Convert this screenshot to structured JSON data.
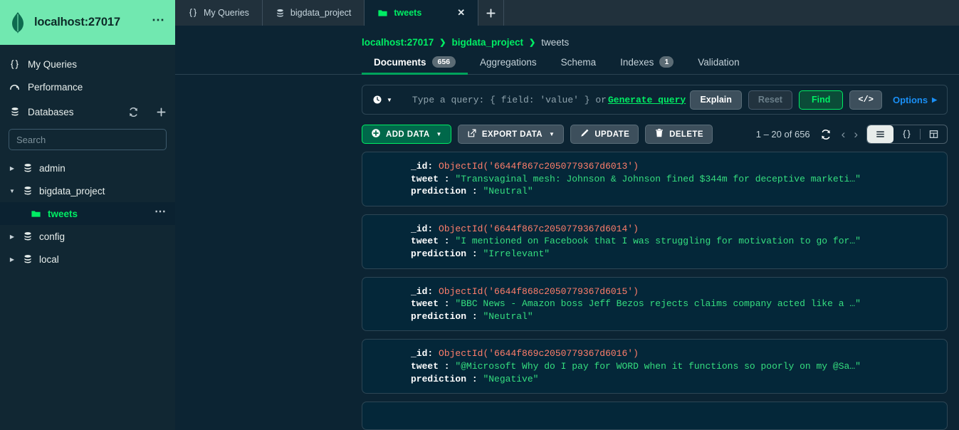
{
  "sidebar": {
    "host": "localhost:27017",
    "logo_icon": "mongodb-leaf-icon",
    "menu_icon": "ellipsis-icon",
    "nav": [
      {
        "label": "My Queries",
        "icon": "braces-icon"
      },
      {
        "label": "Performance",
        "icon": "gauge-icon"
      }
    ],
    "databases_label": "Databases",
    "databases_icon": "database-icon",
    "refresh_icon": "refresh-icon",
    "add_icon": "plus-icon",
    "search_placeholder": "Search",
    "tree": [
      {
        "label": "admin",
        "icon": "database-icon",
        "expanded": false
      },
      {
        "label": "bigdata_project",
        "icon": "database-icon",
        "expanded": true
      },
      {
        "label": "config",
        "icon": "database-icon",
        "expanded": false
      },
      {
        "label": "local",
        "icon": "database-icon",
        "expanded": false
      }
    ],
    "collection": {
      "label": "tweets",
      "icon": "folder-icon",
      "menu_icon": "ellipsis-icon"
    }
  },
  "tabs": [
    {
      "label": "My Queries",
      "icon": "braces-icon",
      "active": false
    },
    {
      "label": "bigdata_project",
      "icon": "database-icon",
      "active": false
    },
    {
      "label": "tweets",
      "icon": "folder-icon",
      "active": true
    }
  ],
  "tab_close_icon": "close-icon",
  "tab_new_icon": "plus-icon",
  "breadcrumb": {
    "host": "localhost:27017",
    "database": "bigdata_project",
    "collection": "tweets",
    "separator": "❯"
  },
  "nav_tabs": [
    {
      "label": "Documents",
      "badge": "656",
      "active": true
    },
    {
      "label": "Aggregations",
      "badge": "",
      "active": false
    },
    {
      "label": "Schema",
      "badge": "",
      "active": false
    },
    {
      "label": "Indexes",
      "badge": "1",
      "active": false
    },
    {
      "label": "Validation",
      "badge": "",
      "active": false
    }
  ],
  "query_bar": {
    "history_icon": "clock-icon",
    "placeholder_prefix": "Type a query: { field: 'value' } or ",
    "generate_link": "Generate query",
    "sparkle_icon": "sparkle-icon",
    "explain_label": "Explain",
    "reset_label": "Reset",
    "find_label": "Find",
    "code_label": "</>",
    "options_label": "Options",
    "options_caret": "▶"
  },
  "toolbar": {
    "add_data_label": "ADD DATA",
    "add_data_icon": "plus-circle-icon",
    "export_data_label": "EXPORT DATA",
    "export_data_icon": "export-icon",
    "update_label": "UPDATE",
    "update_icon": "pencil-icon",
    "delete_label": "DELETE",
    "delete_icon": "trash-icon",
    "caret": "▼",
    "pagination": "1 – 20 of 656",
    "refresh_icon": "refresh-icon",
    "prev_icon": "chevron-left-icon",
    "next_icon": "chevron-right-icon",
    "view_list_icon": "list-view-icon",
    "view_json_icon": "json-view-icon",
    "view_table_icon": "table-view-icon",
    "active_view": "list"
  },
  "documents": [
    {
      "id_key": "_id:",
      "id_value": "ObjectId('6644f867c2050779367d6013')",
      "tweet_key": "tweet :",
      "tweet_value": "\"Transvaginal mesh: Johnson & Johnson fined $344m for deceptive marketi…\"",
      "prediction_key": "prediction :",
      "prediction_value": "\"Neutral\""
    },
    {
      "id_key": "_id:",
      "id_value": "ObjectId('6644f867c2050779367d6014')",
      "tweet_key": "tweet :",
      "tweet_value": "\"I mentioned on Facebook that I was struggling for motivation to go for…\"",
      "prediction_key": "prediction :",
      "prediction_value": "\"Irrelevant\""
    },
    {
      "id_key": "_id:",
      "id_value": "ObjectId('6644f868c2050779367d6015')",
      "tweet_key": "tweet :",
      "tweet_value": "\"BBC News - Amazon boss Jeff Bezos rejects claims company acted like a …\"",
      "prediction_key": "prediction :",
      "prediction_value": "\"Neutral\""
    },
    {
      "id_key": "_id:",
      "id_value": "ObjectId('6644f869c2050779367d6016')",
      "tweet_key": "tweet :",
      "tweet_value": "\"@Microsoft Why do I pay for WORD when it functions so poorly on my @Sa…\"",
      "prediction_key": "prediction :",
      "prediction_value": "\"Negative\""
    }
  ],
  "colors": {
    "accent_green": "#00ed64",
    "header_green": "#71e8b0",
    "string_green": "#35de7f",
    "objectid_salmon": "#ff7e6b",
    "options_blue": "#1a8ff5",
    "bg_dark": "#0c2433"
  }
}
